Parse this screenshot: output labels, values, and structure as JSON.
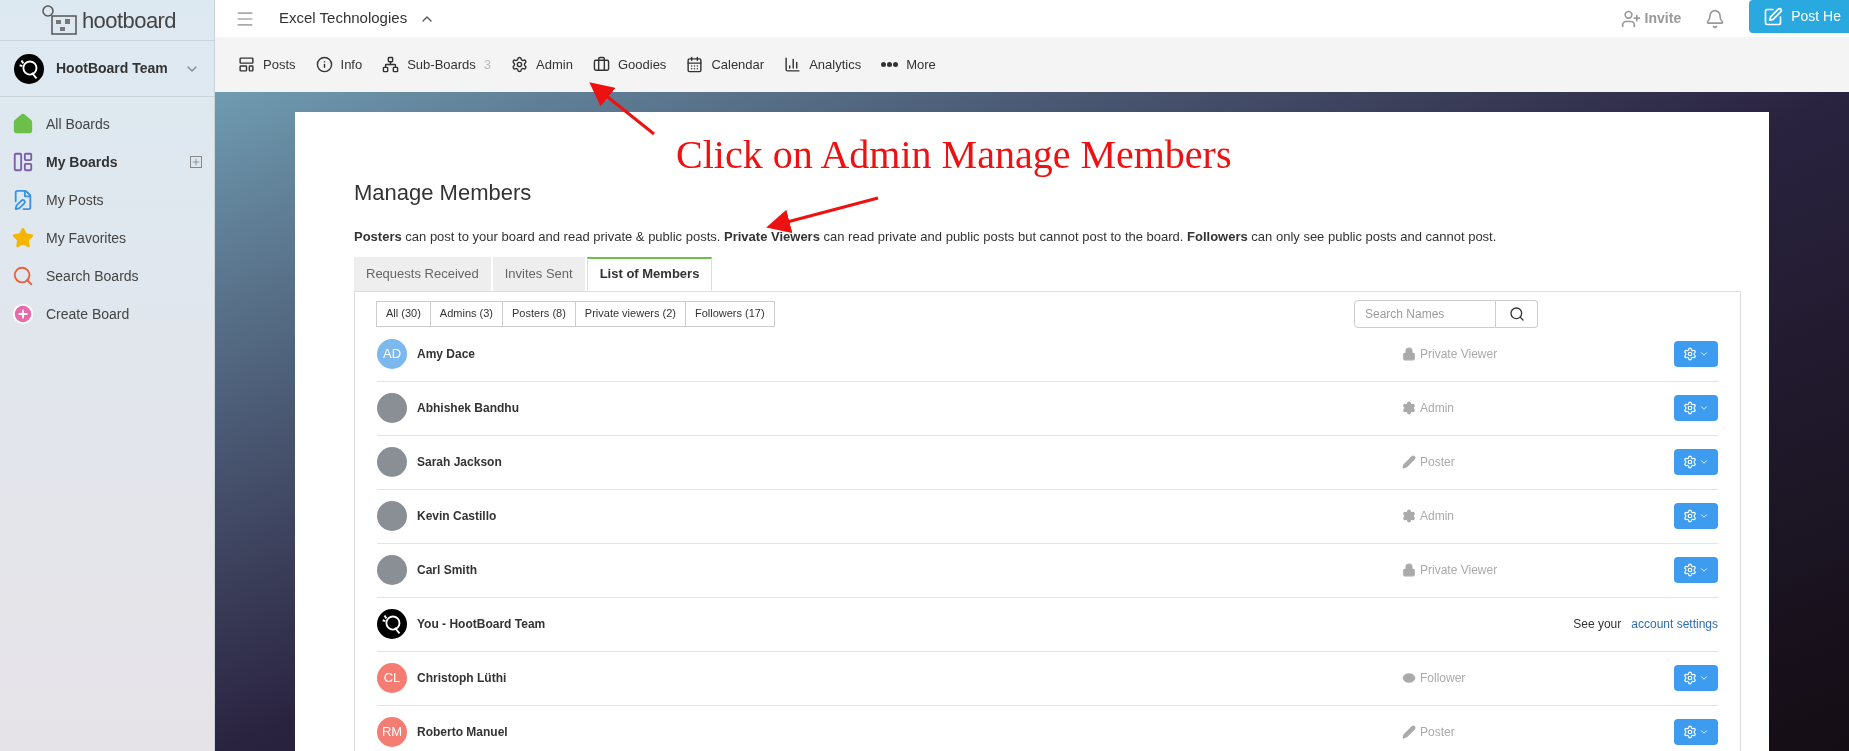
{
  "sidebar": {
    "logo_text": "hootboard",
    "team": {
      "name": "HootBoard Team"
    },
    "items": [
      {
        "label": "All Boards",
        "selected": false,
        "has_add": false
      },
      {
        "label": "My Boards",
        "selected": true,
        "has_add": true
      },
      {
        "label": "My Posts",
        "selected": false,
        "has_add": false
      },
      {
        "label": "My Favorites",
        "selected": false,
        "has_add": false
      },
      {
        "label": "Search Boards",
        "selected": false,
        "has_add": false
      },
      {
        "label": "Create Board",
        "selected": false,
        "has_add": false
      }
    ]
  },
  "header": {
    "board_title": "Excel Technologies",
    "invite": "Invite",
    "post_button": "Post He"
  },
  "nav": [
    {
      "label": "Posts"
    },
    {
      "label": "Info"
    },
    {
      "label": "Sub-Boards",
      "count": "3"
    },
    {
      "label": "Admin"
    },
    {
      "label": "Goodies"
    },
    {
      "label": "Calendar"
    },
    {
      "label": "Analytics"
    },
    {
      "label": "More"
    }
  ],
  "annotation": "Click on Admin Manage Members",
  "page": {
    "title": "Manage Members",
    "description": "**Posters** can post to your board and read private & public posts. **Private Viewers** can read private and public posts but cannot post to the board. **Followers** can only see public posts and cannot post.",
    "tabs": [
      {
        "label": "Requests Received",
        "selected": false
      },
      {
        "label": "Invites Sent",
        "selected": false
      },
      {
        "label": "List of Members",
        "selected": true
      }
    ],
    "filters": [
      {
        "label": "All (30)",
        "selected": false
      },
      {
        "label": "Admins (3)",
        "selected": false
      },
      {
        "label": "Posters (8)",
        "selected": false
      },
      {
        "label": "Private viewers (2)",
        "selected": false
      },
      {
        "label": "Followers (17)",
        "selected": false
      }
    ],
    "search": {
      "placeholder": "Search Names"
    },
    "members": [
      {
        "name": "Amy Dace",
        "initials": "AD",
        "color": "#7ab8ee",
        "role": "Private Viewer",
        "kind": "viewer"
      },
      {
        "name": "Abhishek Bandhu",
        "role": "Admin",
        "kind": "admin"
      },
      {
        "name": "Sarah Jackson",
        "role": "Poster",
        "kind": "poster"
      },
      {
        "name": "Kevin Castillo",
        "role": "Admin",
        "kind": "admin"
      },
      {
        "name": "Carl Smith",
        "role": "Private Viewer",
        "kind": "viewer"
      },
      {
        "name": "You - HootBoard Team",
        "kind": "self",
        "note": "See your",
        "link": "account settings"
      },
      {
        "name": "Christoph Lüthi",
        "initials": "CL",
        "color": "#f47c72",
        "role": "Follower",
        "kind": "follower"
      },
      {
        "name": "Roberto Manuel",
        "initials": "RM",
        "color": "#f47c72",
        "role": "Poster",
        "kind": "poster"
      }
    ]
  }
}
